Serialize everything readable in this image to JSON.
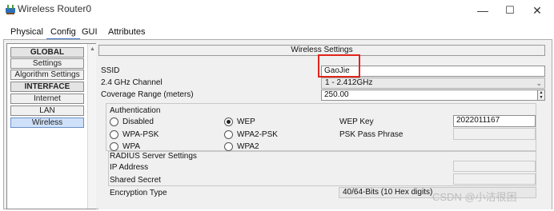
{
  "window": {
    "title": "Wireless Router0",
    "minimize_glyph": "—",
    "maximize_glyph": "☐",
    "close_glyph": "✕"
  },
  "tabs": [
    {
      "label": "Physical"
    },
    {
      "label": "Config"
    },
    {
      "label": "GUI"
    },
    {
      "label": "Attributes"
    }
  ],
  "active_tab": "Config",
  "sidebar": {
    "items": [
      {
        "label": "GLOBAL"
      },
      {
        "label": "Settings"
      },
      {
        "label": "Algorithm Settings"
      },
      {
        "label": "INTERFACE"
      },
      {
        "label": "Internet"
      },
      {
        "label": "LAN"
      },
      {
        "label": "Wireless"
      }
    ],
    "selected": "Wireless"
  },
  "wireless_settings": {
    "section_title": "Wireless Settings",
    "ssid_label": "SSID",
    "ssid_value": "GaoJie",
    "channel_label": "2.4 GHz Channel",
    "channel_value": "1 - 2.412GHz",
    "coverage_label": "Coverage Range (meters)",
    "coverage_value": "250.00",
    "auth": {
      "title": "Authentication",
      "options": [
        {
          "label": "Disabled"
        },
        {
          "label": "WEP"
        },
        {
          "label": "WPA-PSK"
        },
        {
          "label": "WPA2-PSK"
        },
        {
          "label": "WPA"
        },
        {
          "label": "WPA2"
        }
      ],
      "selected": "WEP",
      "wep_key_label": "WEP Key",
      "wep_key_value": "2022011167",
      "psk_label": "PSK Pass Phrase",
      "psk_value": ""
    },
    "radius": {
      "title": "RADIUS Server Settings",
      "ip_label": "IP Address",
      "ip_value": "",
      "secret_label": "Shared Secret",
      "secret_value": ""
    },
    "encryption_label": "Encryption Type",
    "encryption_value": "40/64-Bits (10 Hex digits)"
  },
  "watermark": "CSDN @小洁很困",
  "colors": {
    "highlight_box": "#e1251b",
    "selected_item": "#cfe1f9",
    "panel_bg": "#f0f0f0"
  }
}
